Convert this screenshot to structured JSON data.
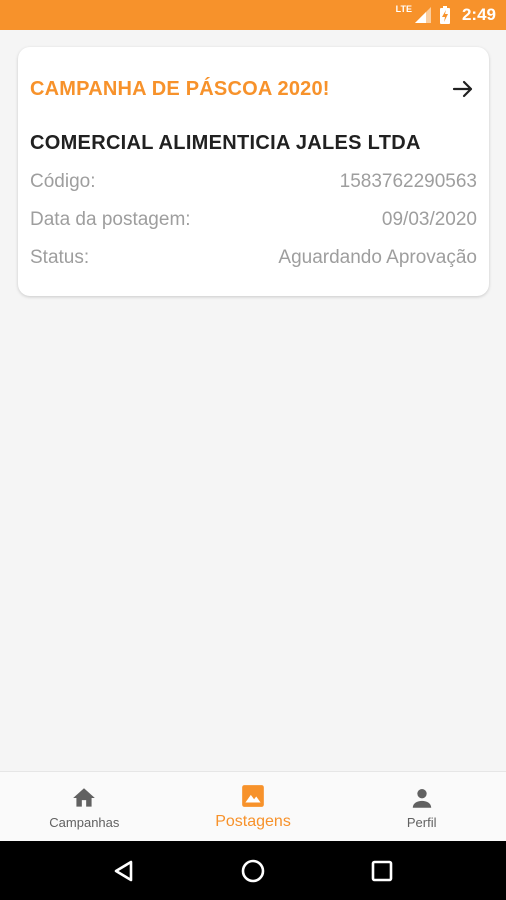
{
  "status_bar": {
    "network": "LTE",
    "time": "2:49",
    "icons": [
      "lte-signal-icon",
      "battery-charging-icon"
    ],
    "bar_color": "#f7922b"
  },
  "card": {
    "title": "CAMPANHA DE PÁSCOA 2020!",
    "company": "COMERCIAL ALIMENTICIA JALES LTDA",
    "fields": [
      {
        "label": "Código:",
        "value": "1583762290563"
      },
      {
        "label": "Data da postagem:",
        "value": "09/03/2020"
      },
      {
        "label": "Status:",
        "value": "Aguardando Aprovação"
      }
    ],
    "action_icon": "arrow-right-icon"
  },
  "bottom_nav": {
    "items": [
      {
        "label": "Campanhas",
        "icon": "home-icon",
        "active": false
      },
      {
        "label": "Postagens",
        "icon": "image-icon",
        "active": true
      },
      {
        "label": "Perfil",
        "icon": "person-icon",
        "active": false
      }
    ],
    "active_color": "#f7922b"
  },
  "system_nav": {
    "buttons": [
      "back-icon",
      "home-circle-icon",
      "recents-icon"
    ]
  }
}
